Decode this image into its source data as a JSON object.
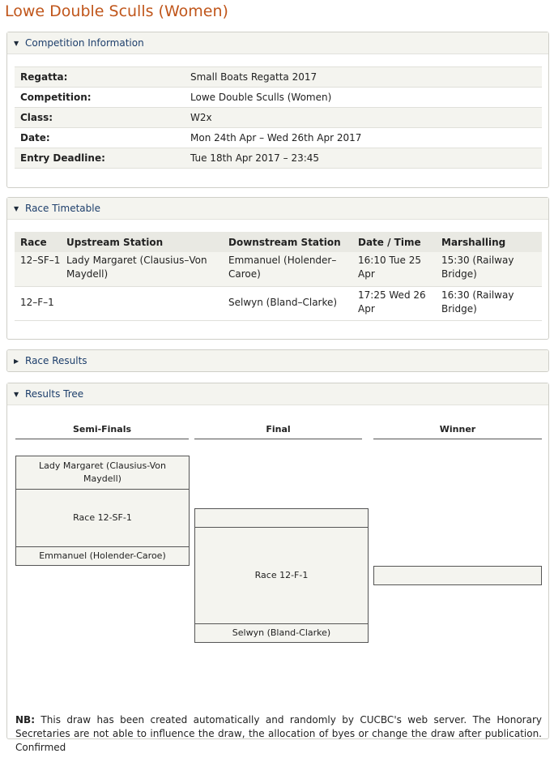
{
  "page_title": "Lowe Double Sculls (Women)",
  "competition_info": {
    "header": "Competition Information",
    "rows": [
      {
        "label": "Regatta:",
        "value": "Small Boats Regatta 2017"
      },
      {
        "label": "Competition:",
        "value": "Lowe Double Sculls (Women)"
      },
      {
        "label": "Class:",
        "value": "W2x"
      },
      {
        "label": "Date:",
        "value": "Mon 24th Apr – Wed 26th Apr 2017"
      },
      {
        "label": "Entry Deadline:",
        "value": "Tue 18th Apr 2017 – 23:45"
      }
    ]
  },
  "race_timetable": {
    "header": "Race Timetable",
    "columns": [
      "Race",
      "Upstream Station",
      "Downstream Station",
      "Date / Time",
      "Marshalling"
    ],
    "rows": [
      {
        "race": "12–SF–1",
        "upstream": "Lady Margaret (Clausius–Von Maydell)",
        "downstream": "Emmanuel (Holender–Caroe)",
        "datetime": "16:10 Tue 25 Apr",
        "marshalling": "15:30 (Railway Bridge)"
      },
      {
        "race": "12–F–1",
        "upstream": "",
        "downstream": "Selwyn (Bland–Clarke)",
        "datetime": "17:25 Wed 26 Apr",
        "marshalling": "16:30 (Railway Bridge)"
      }
    ]
  },
  "race_results": {
    "header": "Race Results"
  },
  "results_tree": {
    "header": "Results Tree",
    "rounds": [
      "Semi-Finals",
      "Final",
      "Winner"
    ],
    "semi_final": {
      "top_crew": "Lady Margaret (Clausius-Von Maydell)",
      "race": "Race 12-SF-1",
      "bottom_crew": "Emmanuel (Holender-Caroe)"
    },
    "final": {
      "top_crew": "",
      "race": "Race 12-F-1",
      "bottom_crew": "Selwyn (Bland-Clarke)"
    },
    "winner": ""
  },
  "nb": {
    "label": "NB:",
    "text": "This draw has been created automatically and randomly by CUCBC's web server. The Honorary Secretaries are not able to influence the draw, the allocation of byes or change the draw after publication. Confirmed"
  }
}
